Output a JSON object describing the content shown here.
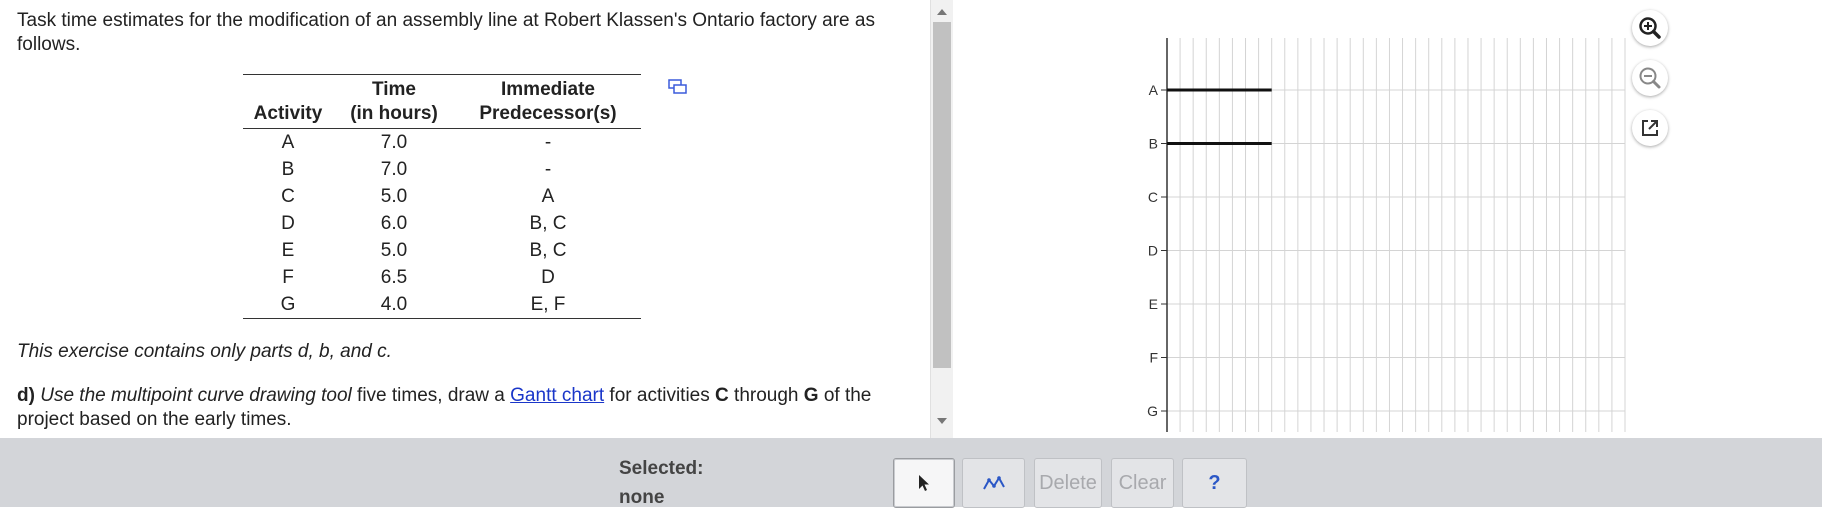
{
  "problem": {
    "intro": "Task time estimates for the modification of an assembly line at Robert Klassen's Ontario factory are as follows.",
    "table": {
      "headers": {
        "activity": "Activity",
        "time_line1": "Time",
        "time_line2": "(in hours)",
        "pred_line1": "Immediate",
        "pred_line2": "Predecessor(s)"
      },
      "rows": [
        {
          "activity": "A",
          "time": "7.0",
          "pred": "-"
        },
        {
          "activity": "B",
          "time": "7.0",
          "pred": "-"
        },
        {
          "activity": "C",
          "time": "5.0",
          "pred": "A"
        },
        {
          "activity": "D",
          "time": "6.0",
          "pred": "B, C"
        },
        {
          "activity": "E",
          "time": "5.0",
          "pred": "B, C"
        },
        {
          "activity": "F",
          "time": "6.5",
          "pred": "D"
        },
        {
          "activity": "G",
          "time": "4.0",
          "pred": "E, F"
        }
      ]
    },
    "note": "This exercise contains only parts d, b, and c.",
    "partd": {
      "label": "d)",
      "italic": "Use the multipoint curve drawing tool",
      "text1": " five times, draw a ",
      "link": "Gantt chart",
      "text2": " for activities ",
      "from": "C",
      "text3": " through ",
      "to": "G",
      "text4": " of the project based on the early times."
    }
  },
  "chart_data": {
    "type": "gantt",
    "activities": [
      "A",
      "B",
      "C",
      "D",
      "E",
      "F",
      "G"
    ],
    "x_range": [
      0,
      35
    ],
    "gridlines_per_unit": 1,
    "bars": [
      {
        "activity": "A",
        "start": 0,
        "end": 8
      },
      {
        "activity": "B",
        "start": 0,
        "end": 8
      }
    ],
    "grid": true
  },
  "graph_tools": {
    "zoom_in_icon": "zoom-in-icon",
    "zoom_out_icon": "zoom-out-icon",
    "popout_icon": "popout-icon"
  },
  "toolbar": {
    "selected_label": "Selected:",
    "selected_value": "none",
    "delete_label": "Delete",
    "clear_label": "Clear",
    "help_label": "?"
  }
}
